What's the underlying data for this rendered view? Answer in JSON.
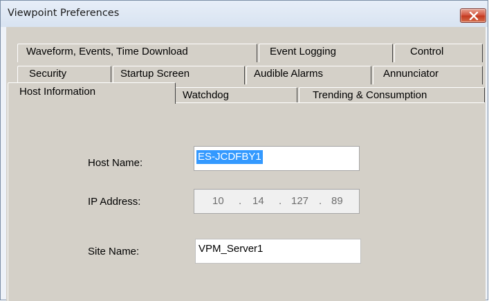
{
  "window": {
    "title": "Viewpoint Preferences",
    "close_glyph": "✕"
  },
  "tabs": {
    "row1": [
      "Waveform, Events, Time Download",
      "Event Logging",
      "Control"
    ],
    "row2": [
      "Security",
      "Startup Screen",
      "Audible Alarms",
      "Annunciator"
    ],
    "row3": [
      "Host Information",
      "Watchdog",
      "Trending & Consumption"
    ],
    "active": "Host Information"
  },
  "host_information": {
    "host_name_label": "Host Name:",
    "host_name_value": "ES-JCDFBY1",
    "ip_address_label": "IP Address:",
    "ip_octets": [
      "10",
      "14",
      "127",
      "89"
    ],
    "ip_separator": ".",
    "site_name_label": "Site Name:",
    "site_name_value": "VPM_Server1"
  }
}
